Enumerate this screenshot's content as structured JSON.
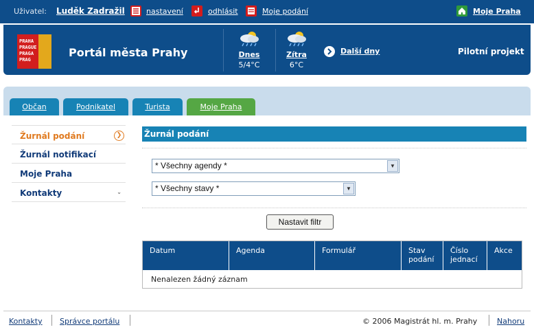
{
  "topbar": {
    "user_label": "Uživatel:",
    "user_name": "Luděk Zadražil",
    "links": {
      "settings": "nastavení",
      "logout": "odhlásit",
      "my_submissions": "Moje podání",
      "my_prague": "Moje Praha"
    }
  },
  "header": {
    "logo_lines": [
      "PRAHA",
      "PRAGUE",
      "PRAGA",
      "PRAG"
    ],
    "portal_title": "Portál města Prahy",
    "weather": [
      {
        "day": "Dnes",
        "temp": "5/4°C",
        "icon": "rain-cloud-sun-icon"
      },
      {
        "day": "Zítra",
        "temp": "6°C",
        "icon": "rain-cloud-sun-icon"
      }
    ],
    "more_days": "Další dny",
    "pilot": "Pilotní projekt"
  },
  "tabs": [
    {
      "label": "Občan",
      "active": false
    },
    {
      "label": "Podnikatel",
      "active": false
    },
    {
      "label": "Turista",
      "active": false
    },
    {
      "label": "Moje Praha",
      "active": true
    }
  ],
  "sidebar": {
    "items": [
      {
        "label": "Žurnál podání",
        "active": true
      },
      {
        "label": "Žurnál notifikací"
      },
      {
        "label": "Moje Praha"
      },
      {
        "label": "Kontakty"
      }
    ]
  },
  "content": {
    "title": "Žurnál podání",
    "agenda_select": "* Všechny agendy *",
    "status_select": "* Všechny stavy *",
    "filter_button": "Nastavit filtr",
    "table": {
      "columns": [
        "Datum",
        "Agenda",
        "Formulář",
        "Stav podání",
        "Číslo jednací",
        "Akce"
      ],
      "empty_message": "Nenalezen žádný záznam"
    }
  },
  "footer": {
    "links": {
      "contacts": "Kontakty",
      "admin": "Správce portálu",
      "top": "Nahoru"
    },
    "copyright": "© 2006 Magistrát hl. m. Prahy"
  },
  "colors": {
    "brand_blue": "#0e4d8a",
    "tab_blue": "#1783b5",
    "tab_active_green": "#55a744",
    "accent_orange": "#e07a1f"
  }
}
